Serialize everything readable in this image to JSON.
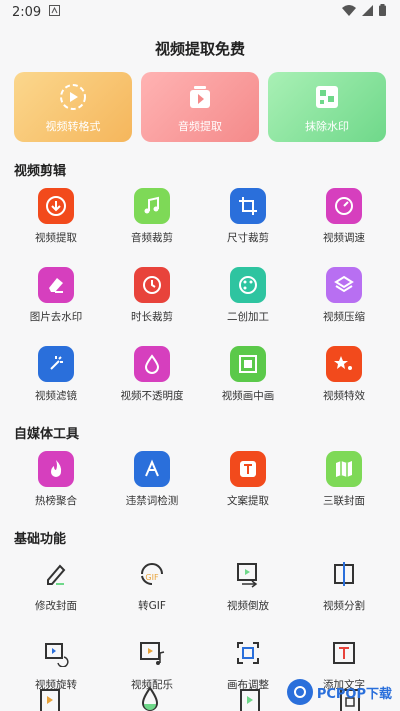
{
  "status": {
    "time": "2:09"
  },
  "page": {
    "title": "视频提取免费"
  },
  "top_cards": [
    {
      "label": "视频转格式",
      "icon": "play-circle-icon"
    },
    {
      "label": "音频提取",
      "icon": "music-video-icon"
    },
    {
      "label": "抹除水印",
      "icon": "eraser-grid-icon"
    }
  ],
  "sections": {
    "video_edit": "视频剪辑",
    "media_tools": "自媒体工具",
    "basic": "基础功能"
  },
  "video_edit_items": [
    {
      "label": "视频提取",
      "icon": "download-icon",
      "color": "#f24a1c"
    },
    {
      "label": "音频裁剪",
      "icon": "music-note-icon",
      "color": "#7ed957"
    },
    {
      "label": "尺寸裁剪",
      "icon": "crop-icon",
      "color": "#2a6fdb"
    },
    {
      "label": "视频调速",
      "icon": "speed-icon",
      "color": "#d63fbe"
    },
    {
      "label": "图片去水印",
      "icon": "eraser-icon",
      "color": "#d63fbe"
    },
    {
      "label": "时长裁剪",
      "icon": "clock-icon",
      "color": "#e8433b"
    },
    {
      "label": "二创加工",
      "icon": "palette-icon",
      "color": "#2ec4a0"
    },
    {
      "label": "视频压缩",
      "icon": "layers-icon",
      "color": "#b86ff2"
    },
    {
      "label": "视频滤镜",
      "icon": "sparkle-icon",
      "color": "#2a6fdb"
    },
    {
      "label": "视频不透明度",
      "icon": "drop-icon",
      "color": "#d63fbe"
    },
    {
      "label": "视频画中画",
      "icon": "picture-in-picture-icon",
      "color": "#5bc94a"
    },
    {
      "label": "视频特效",
      "icon": "stars-icon",
      "color": "#f24a1c"
    }
  ],
  "media_items": [
    {
      "label": "热榜聚合",
      "icon": "flame-icon",
      "color": "#d63fbe"
    },
    {
      "label": "违禁词检测",
      "icon": "text-check-icon",
      "color": "#2a6fdb"
    },
    {
      "label": "文案提取",
      "icon": "text-extract-icon",
      "color": "#f24a1c"
    },
    {
      "label": "三联封面",
      "icon": "map-icon",
      "color": "#7ed957"
    }
  ],
  "basic_items": [
    {
      "label": "修改封面",
      "icon": "pencil-icon"
    },
    {
      "label": "转GIF",
      "icon": "gif-icon"
    },
    {
      "label": "视频倒放",
      "icon": "reverse-icon"
    },
    {
      "label": "视频分割",
      "icon": "split-icon"
    },
    {
      "label": "视频旋转",
      "icon": "rotate-icon"
    },
    {
      "label": "视频配乐",
      "icon": "video-music-icon"
    },
    {
      "label": "画布调整",
      "icon": "canvas-icon"
    },
    {
      "label": "添加文字",
      "icon": "add-text-icon"
    }
  ],
  "watermark": {
    "text": "PCPOP下载"
  }
}
